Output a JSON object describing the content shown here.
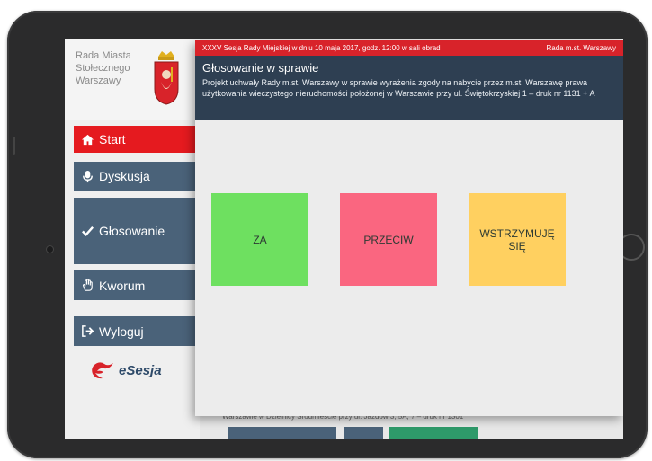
{
  "sidebar": {
    "brand_lines": [
      "Rada Miasta",
      "Stołecznego",
      "Warszawy"
    ],
    "nav": [
      {
        "label": "Start",
        "icon": "home-icon",
        "active": true
      },
      {
        "label": "Dyskusja",
        "icon": "microphone-icon"
      },
      {
        "label": "Głosowanie",
        "icon": "check-icon"
      },
      {
        "label": "Kworum",
        "icon": "hand-icon"
      },
      {
        "label": "Wyloguj",
        "icon": "logout-icon"
      }
    ],
    "logo_text": "eSesja"
  },
  "topbar": {
    "session": "XXXV Sesja Rady Miejskiej w dniu 10 maja 2017, godz. 12:00 w sali obrad",
    "council": "Rada m.st. Warszawy"
  },
  "modal": {
    "title": "Głosowanie w sprawie",
    "description": "Projekt uchwały Rady m.st. Warszawy w sprawie wyrażenia zgody na nabycie przez m.st. Warszawę prawa użytkowania wieczystego nieruchomości położonej w Warszawie przy ul. Świętokrzyskiej 1 – druk nr 1131 + A"
  },
  "votes": {
    "za": "ZA",
    "przeciw": "PRZECIW",
    "wstrzymuje": "WSTRZYMUJĘ SIĘ"
  },
  "background": {
    "strip_text": "Warszawie w Dzielnicy Śródmieście przy ul. Jazdów 3, 5A, 7 – druk nr 1301"
  },
  "colors": {
    "accent_red": "#e51a1f",
    "nav_blue": "#4a6279",
    "header_dark": "#2e3f52",
    "vote_green": "#6ee060",
    "vote_pink": "#fa6680",
    "vote_yellow": "#ffd060"
  }
}
